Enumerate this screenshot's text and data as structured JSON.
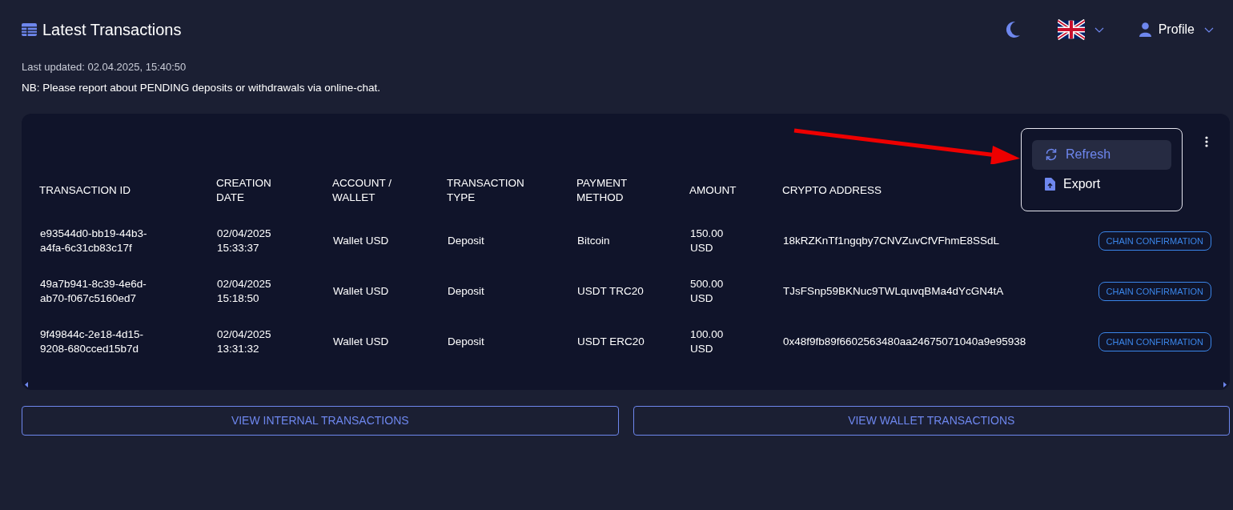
{
  "header": {
    "title": "Latest Transactions",
    "profile_label": "Profile"
  },
  "last_updated": "Last updated: 02.04.2025, 15:40:50",
  "notice": "NB: Please report about PENDING deposits or withdrawals via online-chat.",
  "menu": {
    "items": [
      {
        "label": "Refresh",
        "kind": "refresh",
        "selected": true
      },
      {
        "label": "Export",
        "kind": "export",
        "selected": false
      }
    ]
  },
  "table": {
    "columns": [
      "TRANSACTION ID",
      "CREATION DATE",
      "ACCOUNT / WALLET",
      "TRANSACTION TYPE",
      "PAYMENT METHOD",
      "AMOUNT",
      "CRYPTO ADDRESS"
    ],
    "rows": [
      {
        "cells": [
          "e93544d0-bb19-44b3-a4fa-6c31cb83c17f",
          "02/04/2025 15:33:37",
          "Wallet USD",
          "Deposit",
          "Bitcoin",
          "150.00 USD",
          "18kRZKnTf1ngqby7CNVZuvCfVFhmE8SSdL"
        ],
        "status": "CHAIN CONFIRMATION"
      },
      {
        "cells": [
          "49a7b941-8c39-4e6d-ab70-f067c5160ed7",
          "02/04/2025 15:18:50",
          "Wallet USD",
          "Deposit",
          "USDT TRC20",
          "500.00 USD",
          "TJsFSnp59BKNuc9TWLquvqBMa4dYcGN4tA"
        ],
        "status": "CHAIN CONFIRMATION"
      },
      {
        "cells": [
          "9f49844c-2e18-4d15-9208-680cced15b7d",
          "02/04/2025 13:31:32",
          "Wallet USD",
          "Deposit",
          "USDT ERC20",
          "100.00 USD",
          "0x48f9fb89f6602563480aa24675071040a9e95938"
        ],
        "status": "CHAIN CONFIRMATION"
      }
    ]
  },
  "buttons": [
    "VIEW INTERNAL TRANSACTIONS",
    "VIEW WALLET TRANSACTIONS"
  ]
}
